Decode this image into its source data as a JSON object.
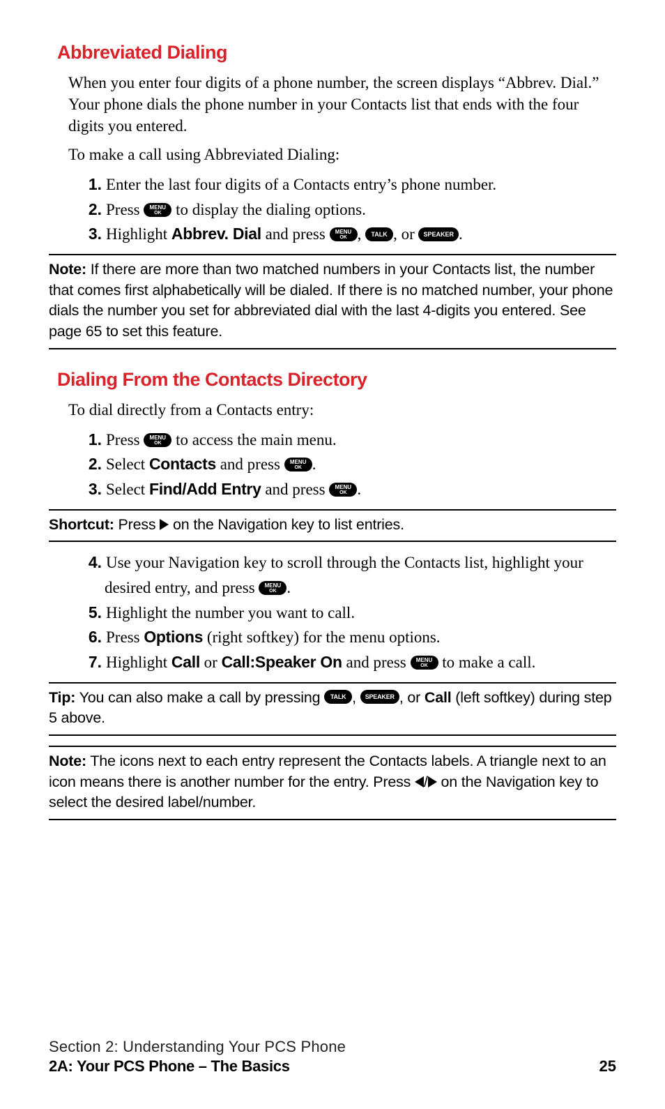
{
  "section1": {
    "heading": "Abbreviated Dialing",
    "intro": "When you enter four digits of a phone number, the screen displays “Abbrev. Dial.” Your phone dials the phone number in your Contacts list that ends with the four digits you entered.",
    "lead": "To make a call using Abbreviated Dialing:",
    "steps": {
      "s1": "Enter the last four digits of a Contacts entry’s phone number.",
      "s2a": "Press ",
      "s2b": " to display the dialing options.",
      "s3a": "Highlight ",
      "s3bold": "Abbrev. Dial",
      "s3b": " and press ",
      "s3c": ", ",
      "s3d": ", or ",
      "s3e": "."
    },
    "noteLead": "Note:",
    "note": " If there are more than two matched numbers in your Contacts list, the number that comes first alphabetically will be dialed. If there is no matched number, your phone dials the number you set for abbreviated dial with the last 4-digits you entered. See page 65 to set this feature."
  },
  "section2": {
    "heading": "Dialing From the Contacts Directory",
    "lead": "To dial directly from a Contacts entry:",
    "stepsA": {
      "s1a": "Press ",
      "s1b": " to access the main menu.",
      "s2a": "Select ",
      "s2bold": "Contacts",
      "s2b": " and press ",
      "s2c": ".",
      "s3a": "Select ",
      "s3bold": "Find/Add Entry",
      "s3b": " and press ",
      "s3c": "."
    },
    "shortcutLead": "Shortcut:",
    "shortcutA": " Press ",
    "shortcutB": " on the Navigation key to list entries.",
    "stepsB": {
      "s4a": "Use your Navigation key to scroll through the Contacts list, highlight your desired entry, and press ",
      "s4b": ".",
      "s5": "Highlight the number you want to call.",
      "s6a": "Press ",
      "s6bold": "Options",
      "s6b": " (right softkey) for the menu options.",
      "s7a": "Highlight ",
      "s7bold1": "Call",
      "s7mid": " or ",
      "s7bold2": "Call:Speaker On",
      "s7b": " and press ",
      "s7c": " to make a call."
    },
    "tipLead": "Tip:",
    "tipA": " You can also make a call by pressing ",
    "tipB": ", ",
    "tipC": ", or ",
    "tipBold": "Call",
    "tipD": " (left softkey) during step 5 above.",
    "note2Lead": "Note:",
    "note2a": " The icons next to each entry represent the Contacts labels. A triangle next to an icon means there is another number for the entry. Press ",
    "note2b": "/",
    "note2c": " on the Navigation key to select the desired label/number."
  },
  "keys": {
    "menuTop": "MENU",
    "menuBottom": "OK",
    "talk": "TALK",
    "speaker": "SPEAKER"
  },
  "footer": {
    "line1": "Section 2: Understanding Your PCS Phone",
    "line2": "2A: Your PCS Phone – The Basics",
    "page": "25"
  }
}
